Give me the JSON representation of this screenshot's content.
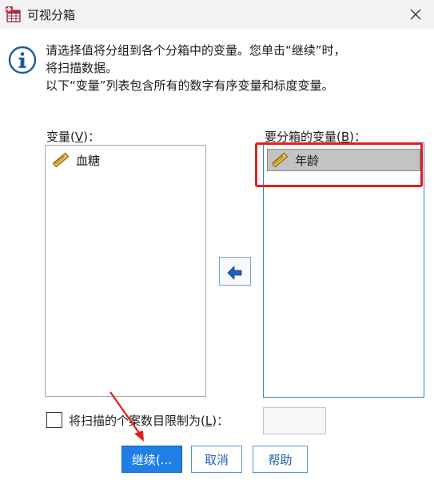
{
  "window": {
    "title": "可视分箱",
    "close_icon": "close-icon"
  },
  "info": {
    "icon": "info-icon",
    "lines": [
      "请选择值将分组到各个分箱中的变量。您单击“继续”时，",
      "将扫描数据。",
      "以下“变量”列表包含所有的数字有序变量和标度变量。"
    ]
  },
  "variables_panel": {
    "label_prefix": "变量(",
    "label_key": "V",
    "label_suffix": ")：",
    "items": [
      {
        "label": "血糖",
        "icon": "ruler-icon"
      }
    ]
  },
  "bin_panel": {
    "label_prefix": "要分箱的变量(",
    "label_key": "B",
    "label_suffix": ")：",
    "items": [
      {
        "label": "年龄",
        "icon": "ruler-icon",
        "selected": true
      }
    ]
  },
  "move_button": {
    "icon": "arrow-left-icon"
  },
  "limit": {
    "label_prefix": "将扫描的个案数目限制为(",
    "label_key": "L",
    "label_suffix": ")：",
    "checked": false,
    "value": ""
  },
  "buttons": {
    "continue": "继续(...",
    "cancel": "取消",
    "help": "帮助"
  },
  "annotation_colors": {
    "highlight": "#e02020",
    "arrow": "#e02020",
    "primary": "#1f7fe6"
  }
}
